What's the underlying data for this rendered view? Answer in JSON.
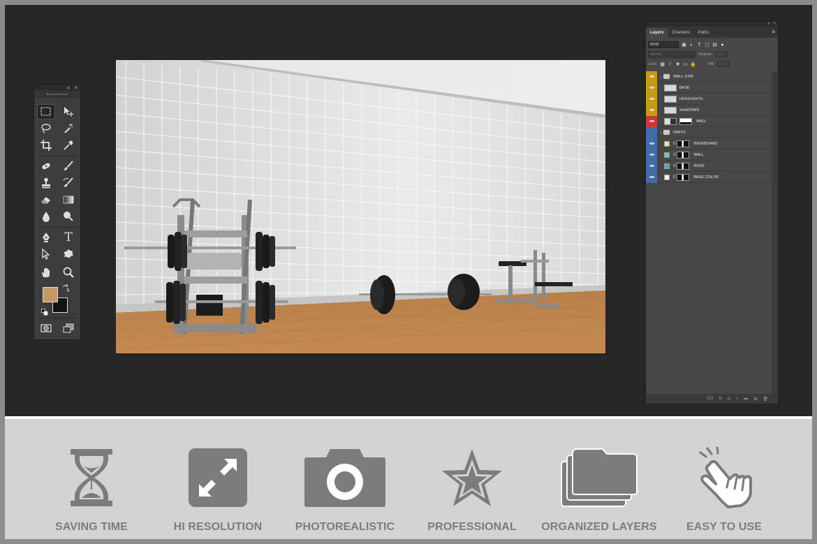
{
  "tools_panel": {
    "collapse_glyph": "«",
    "close_glyph": "×",
    "tools": [
      {
        "name": "marquee-tool-icon",
        "active": true
      },
      {
        "name": "move-tool-icon"
      },
      {
        "name": "lasso-tool-icon"
      },
      {
        "name": "magic-wand-tool-icon"
      },
      {
        "name": "crop-tool-icon"
      },
      {
        "name": "eyedropper-tool-icon"
      },
      {
        "name": "healing-brush-tool-icon"
      },
      {
        "name": "brush-tool-icon"
      },
      {
        "name": "clone-stamp-tool-icon"
      },
      {
        "name": "history-brush-tool-icon"
      },
      {
        "name": "eraser-tool-icon"
      },
      {
        "name": "gradient-tool-icon"
      },
      {
        "name": "blur-tool-icon"
      },
      {
        "name": "dodge-tool-icon"
      },
      {
        "name": "pen-tool-icon"
      },
      {
        "name": "type-tool-icon"
      },
      {
        "name": "path-selection-tool-icon"
      },
      {
        "name": "custom-shape-tool-icon"
      },
      {
        "name": "hand-tool-icon"
      },
      {
        "name": "zoom-tool-icon"
      },
      {
        "name": "quick-mask-icon"
      },
      {
        "name": "screen-mode-icon"
      }
    ],
    "type_tool_glyph": "T",
    "foreground_color": "#c29a62",
    "background_color": "#111111"
  },
  "layers_panel": {
    "collapse_glyph": "«",
    "close_glyph": "×",
    "menu_glyph": "≡",
    "tabs": [
      "Layers",
      "Channels",
      "Paths"
    ],
    "filter_kind": "Kind",
    "blend_mode": "Normal",
    "opacity_label": "Opacity:",
    "opacity_value": "100%",
    "lock_label": "Lock:",
    "fill_label": "Fill:",
    "fill_value": "100%",
    "layers": [
      {
        "name": "WALL GYM",
        "type": "group",
        "color": "yellow"
      },
      {
        "name": "BASE",
        "type": "layer",
        "color": "yellow"
      },
      {
        "name": "HIGHLIGHTS",
        "type": "layer",
        "color": "yellow"
      },
      {
        "name": "SHADOWS",
        "type": "layer",
        "color": "yellow"
      },
      {
        "name": "WALL",
        "type": "smart",
        "color": "red"
      },
      {
        "name": "PARTS",
        "type": "group",
        "color": "blue"
      },
      {
        "name": "BASEBOARD",
        "type": "fill",
        "color": "blue"
      },
      {
        "name": "WALL",
        "type": "fill",
        "color": "blue"
      },
      {
        "name": "ROOF",
        "type": "fill",
        "color": "blue"
      },
      {
        "name": "BASE COLOR",
        "type": "fill",
        "color": "blue"
      }
    ],
    "footer_icons": [
      "link-layers-icon",
      "fx-icon",
      "add-mask-icon",
      "adjustment-icon",
      "new-group-icon",
      "new-layer-icon",
      "delete-layer-icon"
    ],
    "footer_glyphs": [
      "GO",
      "fx",
      "◘",
      "◐",
      "▬",
      "⊞",
      "🗑"
    ]
  },
  "colors": {
    "yellow": "#c89a1c",
    "red": "#c83a3a",
    "blue": "#3f6ea6",
    "feature_gray": "#7c7c7c"
  },
  "features": [
    {
      "label": "SAVING TIME",
      "icon": "hourglass-icon"
    },
    {
      "label": "HI RESOLUTION",
      "icon": "resize-arrows-icon"
    },
    {
      "label": "PHOTOREALISTIC",
      "icon": "camera-icon"
    },
    {
      "label": "PROFESSIONAL",
      "icon": "star-icon"
    },
    {
      "label": "ORGANIZED LAYERS",
      "icon": "layers-folder-icon"
    },
    {
      "label": "EASY TO USE",
      "icon": "pointing-hand-icon"
    }
  ]
}
